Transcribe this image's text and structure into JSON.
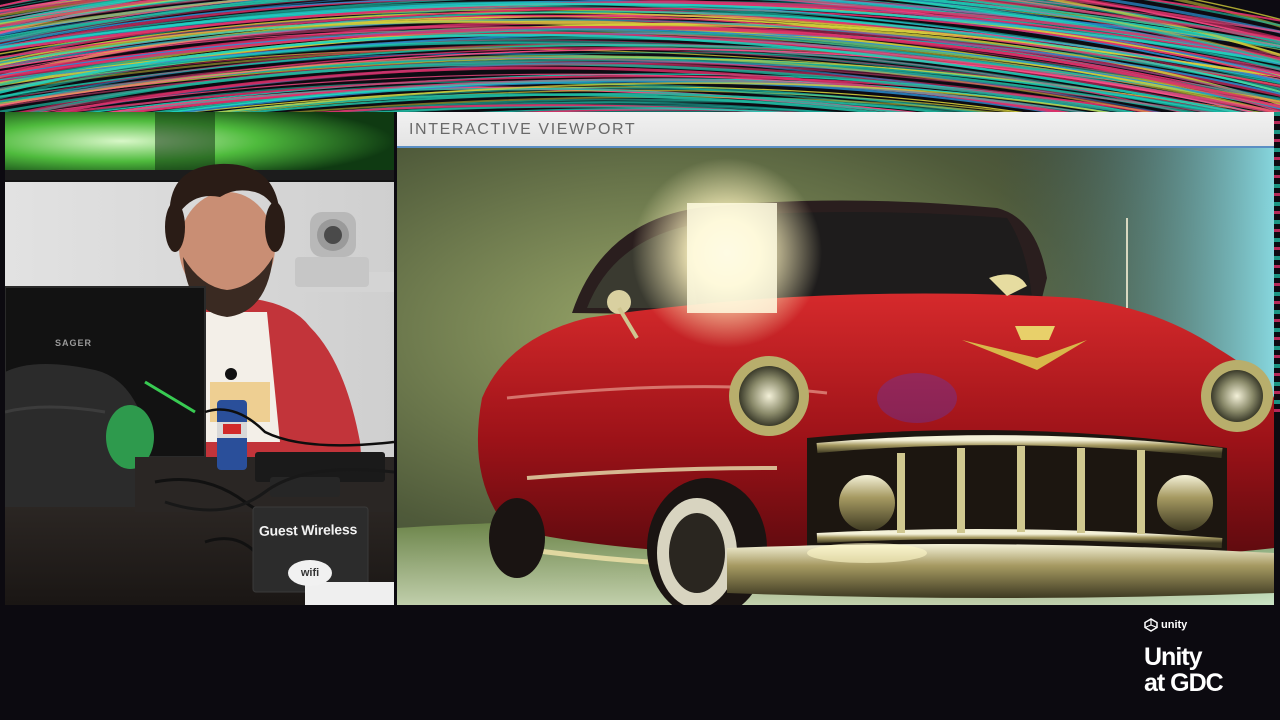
{
  "viewport": {
    "title": "INTERACTIVE VIEWPORT"
  },
  "camera_feed": {
    "sign_text": "Guest Wireless",
    "wifi_text": "wifi",
    "laptop_brand": "SAGER"
  },
  "logo": {
    "small_text": "unity",
    "line1": "Unity",
    "line2": "at GDC"
  },
  "colors": {
    "background": "#0c0a10",
    "viewport_header": "#e9e9e9",
    "viewport_accent": "#5b8fc4",
    "car_red": "#b0141c",
    "streak_teal": "#1fb8a0",
    "streak_magenta": "#e0306a",
    "streak_yellow": "#d6d13a"
  },
  "icons": [
    "unity-cube-icon",
    "wifi-icon"
  ]
}
